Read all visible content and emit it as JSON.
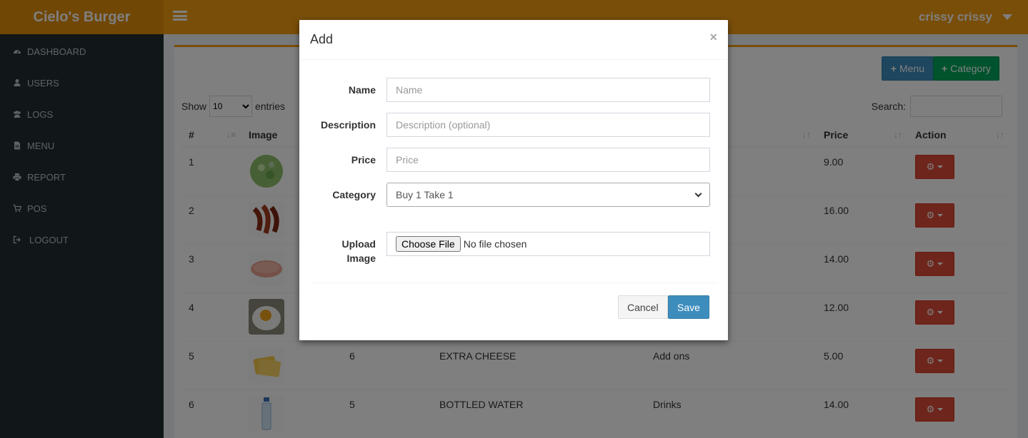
{
  "header": {
    "brand": "Cielo's Burger",
    "user_name": "crissy crissy"
  },
  "sidebar": {
    "items": [
      {
        "label": "DASHBOARD",
        "icon": "dashboard-icon"
      },
      {
        "label": "USERS",
        "icon": "user-icon"
      },
      {
        "label": "LOGS",
        "icon": "users-group-icon"
      },
      {
        "label": "MENU",
        "icon": "file-icon"
      },
      {
        "label": "REPORT",
        "icon": "print-icon"
      },
      {
        "label": "POS",
        "icon": "cart-icon"
      },
      {
        "label": "LOGOUT",
        "icon": "sign-out-icon"
      }
    ]
  },
  "toolbar": {
    "add_menu_label": "Menu",
    "add_category_label": "Category"
  },
  "table_controls": {
    "show_label": "Show",
    "entries_value": "10",
    "entries_label": "entries",
    "search_label": "Search:"
  },
  "table": {
    "headers": [
      "#",
      "Image",
      "",
      "",
      "",
      "Price",
      "Action"
    ],
    "rows": [
      {
        "num": "1",
        "img": "salad",
        "id": "",
        "name": "",
        "category": "",
        "price": "9.00"
      },
      {
        "num": "2",
        "img": "bacon",
        "id": "",
        "name": "",
        "category": "",
        "price": "16.00"
      },
      {
        "num": "3",
        "img": "ham",
        "id": "",
        "name": "",
        "category": "",
        "price": "14.00"
      },
      {
        "num": "4",
        "img": "egg",
        "id": "",
        "name": "",
        "category": "",
        "price": "12.00"
      },
      {
        "num": "5",
        "img": "cheese",
        "id": "6",
        "name": "EXTRA CHEESE",
        "category": "Add ons",
        "price": "5.00"
      },
      {
        "num": "6",
        "img": "water",
        "id": "5",
        "name": "BOTTLED WATER",
        "category": "Drinks",
        "price": "14.00"
      }
    ]
  },
  "modal": {
    "title": "Add",
    "close": "×",
    "name_label": "Name",
    "name_placeholder": "Name",
    "description_label": "Description",
    "description_placeholder": "Description (optional)",
    "price_label": "Price",
    "price_placeholder": "Price",
    "category_label": "Category",
    "category_value": "Buy 1 Take 1",
    "upload_label_1": "Upload",
    "upload_label_2": "Image",
    "file_button": "Choose File",
    "file_status": "No file chosen",
    "cancel_label": "Cancel",
    "save_label": "Save"
  }
}
